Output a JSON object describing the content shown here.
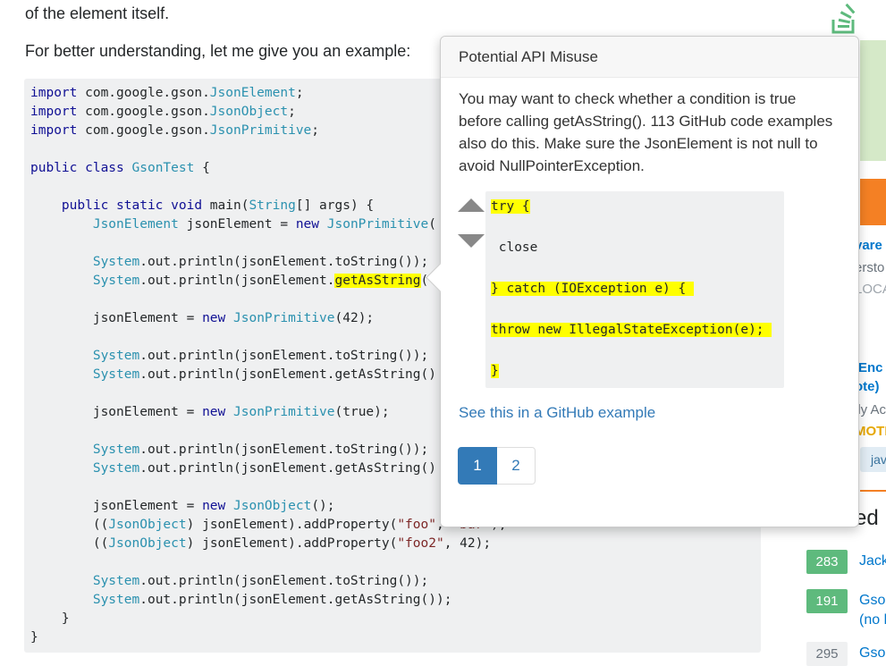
{
  "intro": {
    "line1": "of the element itself.",
    "line2": "For better understanding, let me give you an example:"
  },
  "code_lines": [
    {
      "segments": [
        {
          "t": "import",
          "c": "kw"
        },
        {
          "t": " com.google.gson."
        },
        {
          "t": "JsonElement",
          "c": "ty"
        },
        {
          "t": ";"
        }
      ]
    },
    {
      "segments": [
        {
          "t": "import",
          "c": "kw"
        },
        {
          "t": " com.google.gson."
        },
        {
          "t": "JsonObject",
          "c": "ty"
        },
        {
          "t": ";"
        }
      ]
    },
    {
      "segments": [
        {
          "t": "import",
          "c": "kw"
        },
        {
          "t": " com.google.gson."
        },
        {
          "t": "JsonPrimitive",
          "c": "ty"
        },
        {
          "t": ";"
        }
      ]
    },
    {
      "segments": []
    },
    {
      "segments": [
        {
          "t": "public class",
          "c": "kw"
        },
        {
          "t": " "
        },
        {
          "t": "GsonTest",
          "c": "ty"
        },
        {
          "t": " {"
        }
      ]
    },
    {
      "segments": []
    },
    {
      "segments": [
        {
          "t": "    "
        },
        {
          "t": "public static void",
          "c": "kw"
        },
        {
          "t": " main("
        },
        {
          "t": "String",
          "c": "ty"
        },
        {
          "t": "[] args) {"
        }
      ]
    },
    {
      "segments": [
        {
          "t": "        "
        },
        {
          "t": "JsonElement",
          "c": "ty"
        },
        {
          "t": " jsonElement = "
        },
        {
          "t": "new",
          "c": "kw"
        },
        {
          "t": " "
        },
        {
          "t": "JsonPrimitive",
          "c": "ty"
        },
        {
          "t": "("
        }
      ]
    },
    {
      "segments": []
    },
    {
      "segments": [
        {
          "t": "        "
        },
        {
          "t": "System",
          "c": "ty"
        },
        {
          "t": ".out.println(jsonElement.toString());"
        }
      ]
    },
    {
      "segments": [
        {
          "t": "        "
        },
        {
          "t": "System",
          "c": "ty"
        },
        {
          "t": ".out.println(jsonElement."
        },
        {
          "t": "getAsString",
          "c": "hl"
        },
        {
          "t": "("
        }
      ]
    },
    {
      "segments": []
    },
    {
      "segments": [
        {
          "t": "        jsonElement = "
        },
        {
          "t": "new",
          "c": "kw"
        },
        {
          "t": " "
        },
        {
          "t": "JsonPrimitive",
          "c": "ty"
        },
        {
          "t": "(42);"
        }
      ]
    },
    {
      "segments": []
    },
    {
      "segments": [
        {
          "t": "        "
        },
        {
          "t": "System",
          "c": "ty"
        },
        {
          "t": ".out.println(jsonElement.toString());"
        }
      ]
    },
    {
      "segments": [
        {
          "t": "        "
        },
        {
          "t": "System",
          "c": "ty"
        },
        {
          "t": ".out.println(jsonElement.getAsString()"
        }
      ]
    },
    {
      "segments": []
    },
    {
      "segments": [
        {
          "t": "        jsonElement = "
        },
        {
          "t": "new",
          "c": "kw"
        },
        {
          "t": " "
        },
        {
          "t": "JsonPrimitive",
          "c": "ty"
        },
        {
          "t": "(true);"
        }
      ]
    },
    {
      "segments": []
    },
    {
      "segments": [
        {
          "t": "        "
        },
        {
          "t": "System",
          "c": "ty"
        },
        {
          "t": ".out.println(jsonElement.toString());"
        }
      ]
    },
    {
      "segments": [
        {
          "t": "        "
        },
        {
          "t": "System",
          "c": "ty"
        },
        {
          "t": ".out.println(jsonElement.getAsString()"
        }
      ]
    },
    {
      "segments": []
    },
    {
      "segments": [
        {
          "t": "        jsonElement = "
        },
        {
          "t": "new",
          "c": "kw"
        },
        {
          "t": " "
        },
        {
          "t": "JsonObject",
          "c": "ty"
        },
        {
          "t": "();"
        }
      ]
    },
    {
      "segments": [
        {
          "t": "        (("
        },
        {
          "t": "JsonObject",
          "c": "ty"
        },
        {
          "t": ") jsonElement).addProperty("
        },
        {
          "t": "\"foo\"",
          "c": "str"
        },
        {
          "t": ", "
        },
        {
          "t": "\"bar\"",
          "c": "str"
        },
        {
          "t": ");"
        }
      ]
    },
    {
      "segments": [
        {
          "t": "        (("
        },
        {
          "t": "JsonObject",
          "c": "ty"
        },
        {
          "t": ") jsonElement).addProperty("
        },
        {
          "t": "\"foo2\"",
          "c": "str"
        },
        {
          "t": ", 42);"
        }
      ]
    },
    {
      "segments": []
    },
    {
      "segments": [
        {
          "t": "        "
        },
        {
          "t": "System",
          "c": "ty"
        },
        {
          "t": ".out.println(jsonElement.toString());"
        }
      ]
    },
    {
      "segments": [
        {
          "t": "        "
        },
        {
          "t": "System",
          "c": "ty"
        },
        {
          "t": ".out.println(jsonElement.getAsString());"
        }
      ]
    },
    {
      "segments": [
        {
          "t": "    }"
        }
      ]
    },
    {
      "segments": [
        {
          "t": "}"
        }
      ]
    }
  ],
  "popover": {
    "title": "Potential API Misuse",
    "body": "You may want to check whether a condition is true before calling getAsString(). 113 GitHub code examples also do this. Make sure the JsonElement is not null to avoid NullPointerException.",
    "snippet_lines": [
      {
        "text": "try {",
        "highlight": true
      },
      {
        "text": " close",
        "highlight": false
      },
      {
        "text": "} catch (IOException e) { ",
        "highlight": true
      },
      {
        "text": "throw new IllegalStateException(e); ",
        "highlight": true
      },
      {
        "text": "}",
        "highlight": true
      }
    ],
    "github_link": "See this in a GitHub example",
    "pages": [
      "1",
      "2"
    ],
    "active_page": "1"
  },
  "sidebar": {
    "snippets": [
      {
        "text": "vare",
        "color": "#0077cc",
        "bold": true
      },
      {
        "text": "ersto",
        "color": "#6a737c",
        "bold": false
      },
      {
        "text": "LOCA",
        "color": "#9fa6ad",
        "bold": false
      },
      {
        "text": " Enc",
        "color": "#0077cc",
        "bold": true
      },
      {
        "text": "ote)",
        "color": "#0077cc",
        "bold": true
      },
      {
        "text": "lly Ac",
        "color": "#6a737c",
        "bold": false
      },
      {
        "text": "MOTI",
        "color": "#e6a700",
        "bold": true
      }
    ],
    "tag": "jav",
    "related_title": "Related",
    "related": [
      {
        "score": "283",
        "title": "Jack",
        "answered": true
      },
      {
        "score": "191",
        "title": "Gso",
        "title2": "(no l",
        "answered": true
      },
      {
        "score": "295",
        "title": "Gso",
        "answered": false
      }
    ],
    "colors": {
      "answered": "#5eba7d",
      "unanswered_bg": "#eff0f1"
    }
  }
}
